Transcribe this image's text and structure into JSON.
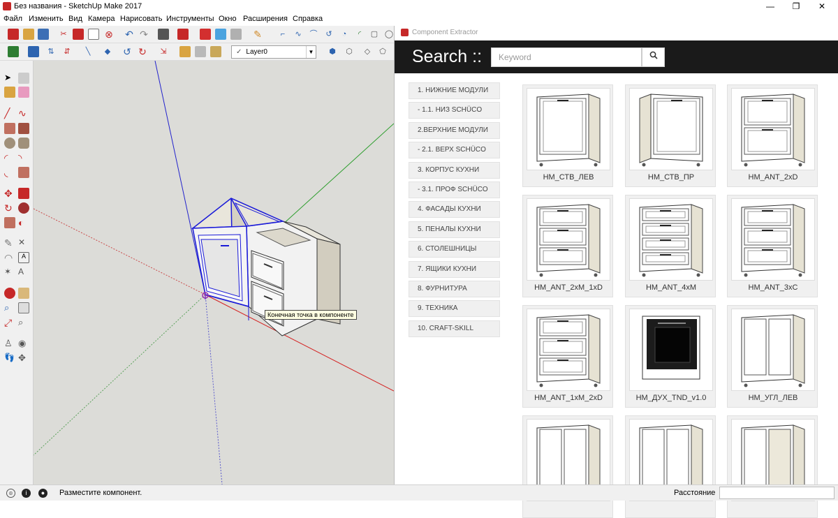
{
  "window": {
    "title": "Без названия - SketchUp Make 2017",
    "controls": [
      "—",
      "❐",
      "✕"
    ]
  },
  "menu": [
    "Файл",
    "Изменить",
    "Вид",
    "Камера",
    "Нарисовать",
    "Инструменты",
    "Окно",
    "Расширения",
    "Справка"
  ],
  "toolbar": {
    "layer_checkmark": "✓",
    "layer_value": "Layer0"
  },
  "viewport": {
    "tooltip": "Конечная точка в компоненте"
  },
  "status": {
    "message": "Разместите компонент.",
    "measure_label": "Расстояние",
    "measure_value": ""
  },
  "panel": {
    "title": "Component Extractor",
    "search_label": "Search ::",
    "search_placeholder": "Keyword",
    "search_icon": "search-icon",
    "categories": [
      "1. НИЖНИЕ МОДУЛИ",
      "- 1.1. НИЗ SCHÜCO",
      "2.ВЕРХНИЕ МОДУЛИ",
      "- 2.1. ВЕРХ SCHÜCO",
      "3. КОРПУС КУХНИ",
      "- 3.1. ПРОФ SCHÜCO",
      "4. ФАСАДЫ КУХНИ",
      "5. ПЕНАЛЫ КУХНИ",
      "6. СТОЛЕШНИЦЫ",
      "7. ЯЩИКИ КУХНИ",
      "8. ФУРНИТУРА",
      "9. ТЕХНИКА",
      "10. CRAFT-SKILL"
    ],
    "components": [
      {
        "label": "НМ_СТВ_ЛЕВ",
        "kind": "door-left"
      },
      {
        "label": "НМ_СТВ_ПР",
        "kind": "door-right"
      },
      {
        "label": "НМ_ANT_2xD",
        "kind": "drawers-2"
      },
      {
        "label": "НМ_ANT_2xM_1xD",
        "kind": "drawers-3"
      },
      {
        "label": "НМ_ANT_4xM",
        "kind": "drawers-4"
      },
      {
        "label": "НМ_ANT_3xC",
        "kind": "drawers-3"
      },
      {
        "label": "НМ_ANT_1xM_2xD",
        "kind": "drawers-3"
      },
      {
        "label": "НМ_ДУХ_TND_v1.0",
        "kind": "oven"
      },
      {
        "label": "НМ_УГЛ_ЛЕВ",
        "kind": "corner"
      },
      {
        "label": "",
        "kind": "door-double"
      },
      {
        "label": "",
        "kind": "door-double"
      },
      {
        "label": "",
        "kind": "corner-open"
      }
    ]
  }
}
